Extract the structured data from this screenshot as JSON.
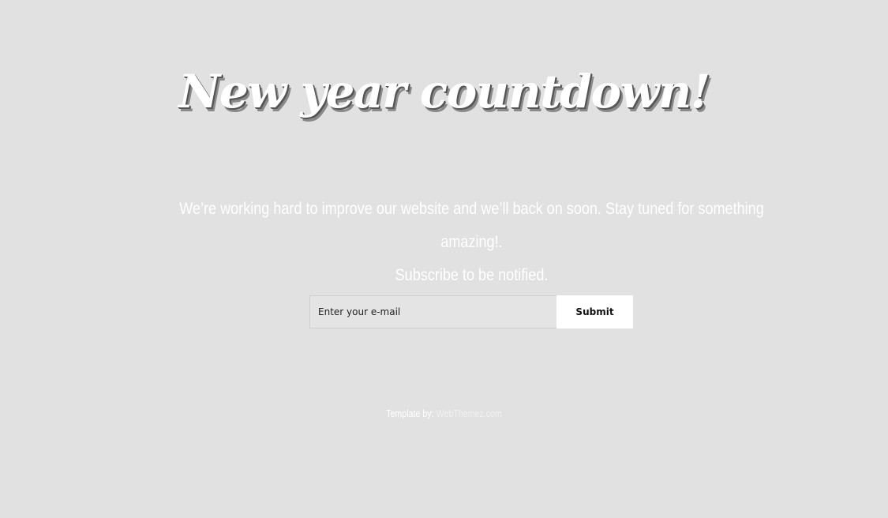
{
  "hero": {
    "title": "New year countdown!"
  },
  "message": {
    "line1": "We’re working hard to improve our website and we’ll back on soon. Stay tuned for something amazing!.",
    "line2": "Subscribe to be notified."
  },
  "subscribe": {
    "email_placeholder": "Enter your e-mail",
    "email_value": "",
    "submit_label": "Submit"
  },
  "footer": {
    "label": "Template by:",
    "link_text": "WebThemez.com"
  },
  "colors": {
    "background": "#e1e1e1",
    "text": "#ffffff",
    "button_bg": "#ffffff",
    "button_text": "#111111"
  }
}
